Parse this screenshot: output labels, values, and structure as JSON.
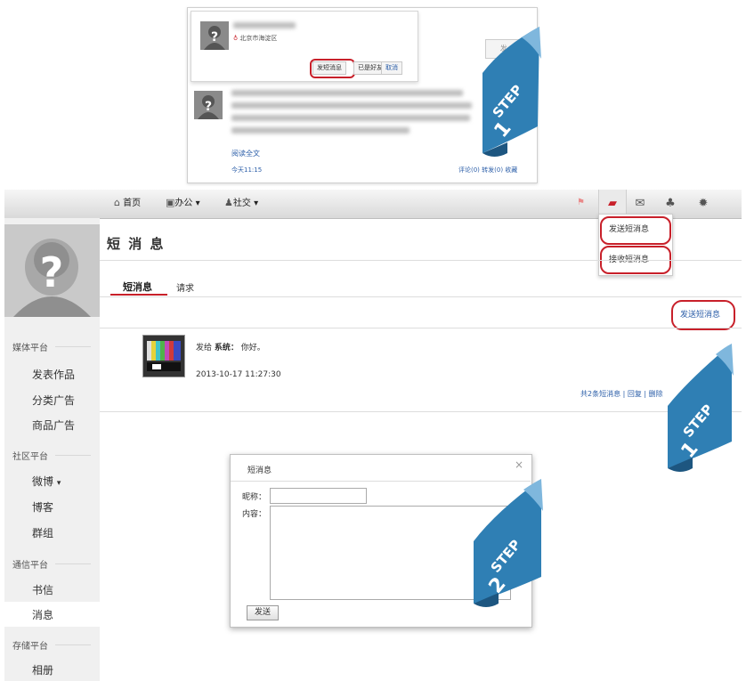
{
  "top_card": {
    "location": "北京市海淀区",
    "send_message_btn": "发短消息",
    "follow_status": "已是好友",
    "cancel": "取消",
    "publish_btn": "发 布",
    "read_more": "阅读全文",
    "post_time": "今天11:15",
    "actions": "评论(0)  转发(0)  收藏"
  },
  "steps": [
    {
      "word": "STEP",
      "num": "1"
    },
    {
      "word": "STEP",
      "num": "1"
    },
    {
      "word": "STEP",
      "num": "2"
    }
  ],
  "nav": {
    "home": "首页",
    "office": "办公",
    "social": "社交",
    "icons": [
      "home-icon",
      "briefcase-icon",
      "user-icon",
      "message-icon",
      "mail-icon",
      "network-icon",
      "gear-icon"
    ]
  },
  "dropdown": {
    "items": [
      "发送短消息",
      "接收短消息"
    ]
  },
  "sidebar": {
    "groups": [
      {
        "label": "媒体平台",
        "items": [
          "发表作品",
          "分类广告",
          "商品广告"
        ]
      },
      {
        "label": "社区平台",
        "items": [
          "微博",
          "博客",
          "群组"
        ]
      },
      {
        "label": "通信平台",
        "items": [
          "书信",
          "消息"
        ]
      },
      {
        "label": "存储平台",
        "items": [
          "相册"
        ]
      }
    ]
  },
  "main": {
    "title": "短 消 息",
    "tabs": [
      "短消息",
      "请求"
    ],
    "send_link": "发送短消息",
    "message": {
      "sender_prefix": "发给",
      "sender": "系统",
      "text": "你好。",
      "time": "2013-10-17 11:27:30",
      "footer": "共2条短消息 | 回复 | 删除"
    }
  },
  "dialog": {
    "title": "短消息",
    "close": "×",
    "nickname_label": "昵称：",
    "content_label": "内容：",
    "send_btn": "发送"
  },
  "colors": {
    "accent_red": "#c8202a",
    "ribbon_blue": "#2f7fb4"
  }
}
